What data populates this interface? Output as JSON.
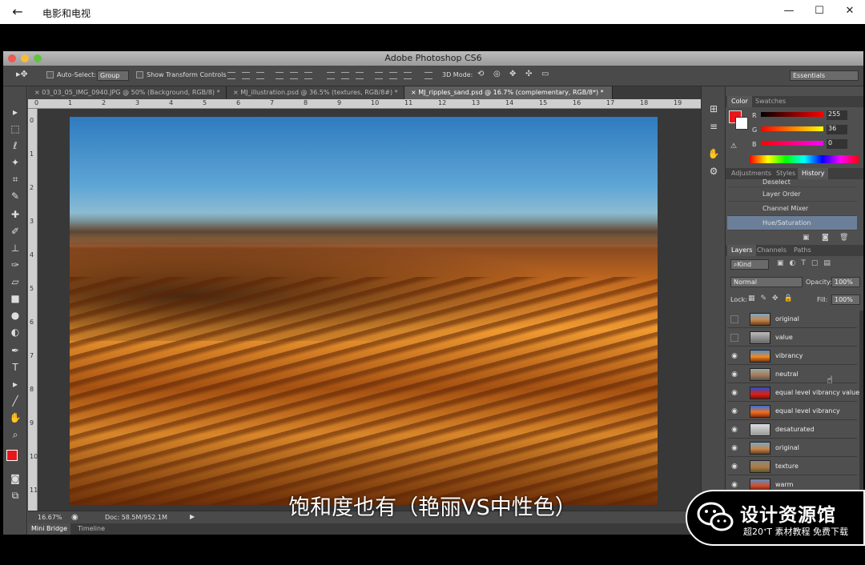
{
  "window": {
    "back_icon": "back-arrow-icon",
    "title": "电影和电视",
    "minimize": "—",
    "maximize": "☐",
    "close": "✕"
  },
  "app": {
    "title": "Adobe Photoshop CS6"
  },
  "options_bar": {
    "auto_select_label": "Auto-Select:",
    "auto_select_value": "Group",
    "transform_label": "Show Transform Controls",
    "mode_3d_label": "3D Mode:",
    "workspace": "Essentials"
  },
  "doc_tabs": [
    {
      "label": "03_03_05_IMG_0940.JPG @ 50% (Background, RGB/8) *"
    },
    {
      "label": "MJ_illustration.psd @ 36.5% (textures, RGB/8#) *"
    },
    {
      "label": "MJ_ripples_sand.psd @ 16.7% (complementary, RGB/8*) *"
    }
  ],
  "ruler": {
    "h": [
      "0",
      "1",
      "2",
      "3",
      "4",
      "5",
      "6",
      "7",
      "8",
      "9",
      "10",
      "11",
      "12",
      "13",
      "14",
      "15",
      "16",
      "17",
      "18",
      "19"
    ],
    "v": [
      "0",
      "1",
      "2",
      "3",
      "4",
      "5",
      "6",
      "7",
      "8",
      "9",
      "10",
      "11"
    ]
  },
  "status": {
    "zoom": "16.67%",
    "doc": "Doc: 58.5M/952.1M"
  },
  "bottom_tabs": {
    "mini_bridge": "Mini Bridge",
    "timeline": "Timeline"
  },
  "color_panel": {
    "tabs": [
      "Color",
      "Swatches"
    ],
    "r_label": "R",
    "g_label": "G",
    "b_label": "B",
    "r": "255",
    "g": "36",
    "b": "0",
    "fg_color": "#e8161b"
  },
  "history_panel": {
    "tabs": [
      "Adjustments",
      "Styles",
      "History"
    ],
    "items": [
      "Deselect",
      "Layer Order",
      "Channel Mixer",
      "Hue/Saturation"
    ]
  },
  "layers_panel": {
    "tabs": [
      "Layers",
      "Channels",
      "Paths"
    ],
    "kind": "Kind",
    "blend_mode": "Normal",
    "opacity_label": "Opacity:",
    "opacity": "100%",
    "lock_label": "Lock:",
    "fill_label": "Fill:",
    "fill": "100%",
    "layers": [
      {
        "name": "original",
        "visible": false
      },
      {
        "name": "value",
        "visible": false
      },
      {
        "name": "vibrancy",
        "visible": true
      },
      {
        "name": "neutral",
        "visible": true
      },
      {
        "name": "equal level vibrancy value",
        "visible": true
      },
      {
        "name": "equal level vibrancy",
        "visible": true
      },
      {
        "name": "desaturated",
        "visible": true
      },
      {
        "name": "original",
        "visible": true
      },
      {
        "name": "texture",
        "visible": true
      },
      {
        "name": "warm",
        "visible": true
      }
    ]
  },
  "subtitle": "饱和度也有（艳丽VS中性色）",
  "watermark": {
    "title": "设计资源馆",
    "subtitle": "超20ᐩT 素材教程 免费下载",
    "logo": "wechat-icon"
  }
}
